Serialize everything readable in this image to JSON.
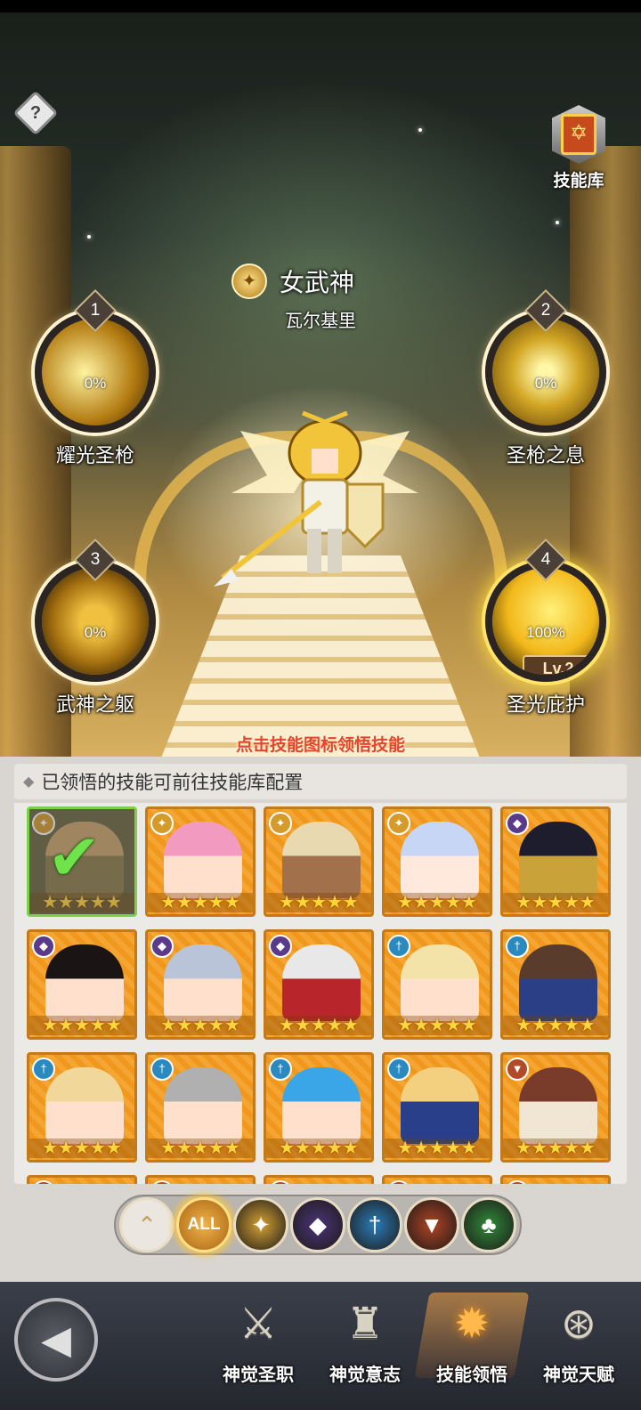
{
  "hero": {
    "title": "女武神",
    "subtitle": "瓦尔基里"
  },
  "skill_library": {
    "label": "技能库",
    "icon": "spellbook-icon"
  },
  "help": {
    "label": "?"
  },
  "skills": [
    {
      "num": "1",
      "name": "耀光圣枪",
      "progress": "0%"
    },
    {
      "num": "2",
      "name": "圣枪之息",
      "progress": "0%"
    },
    {
      "num": "3",
      "name": "武神之躯",
      "progress": "0%"
    },
    {
      "num": "4",
      "name": "圣光庇护",
      "progress": "100%",
      "level": "Lv.2"
    }
  ],
  "hint": "点击技能图标领悟技能",
  "panel": {
    "header": "已领悟的技能可前往技能库配置"
  },
  "cards": [
    {
      "faction": "light",
      "hair": "#c9a46a",
      "skin": "#8a7c4a",
      "selected": true
    },
    {
      "faction": "light",
      "hair": "#f39ac0",
      "skin": "#ffe0cc"
    },
    {
      "faction": "light",
      "hair": "#e8d9b0",
      "skin": "#a2704a"
    },
    {
      "faction": "light",
      "hair": "#c7d6f4",
      "skin": "#ffe8dc"
    },
    {
      "faction": "dark",
      "hair": "#1d1d2e",
      "skin": "#caa23a"
    },
    {
      "faction": "dark",
      "hair": "#1a1414",
      "skin": "#ffe0cc"
    },
    {
      "faction": "dark",
      "hair": "#b9c4d8",
      "skin": "#ffe0cc"
    },
    {
      "faction": "dark",
      "hair": "#e8e8e8",
      "skin": "#b8252a"
    },
    {
      "faction": "holy",
      "hair": "#f4e3a8",
      "skin": "#ffe0cc"
    },
    {
      "faction": "holy",
      "hair": "#5a3c2c",
      "skin": "#2b3f86"
    },
    {
      "faction": "holy",
      "hair": "#f2d79a",
      "skin": "#ffe0cc"
    },
    {
      "faction": "holy",
      "hair": "#b0b0b0",
      "skin": "#ffe0cc"
    },
    {
      "faction": "holy",
      "hair": "#3aa6e8",
      "skin": "#ffe0cc"
    },
    {
      "faction": "holy",
      "hair": "#f2d080",
      "skin": "#2a3f8a"
    },
    {
      "faction": "beast",
      "hair": "#7a3c2a",
      "skin": "#f1e6d4"
    },
    {
      "faction": "beast",
      "hair": "#555",
      "skin": "#444"
    },
    {
      "faction": "beast",
      "hair": "#555",
      "skin": "#444"
    },
    {
      "faction": "beast",
      "hair": "#e8c030",
      "skin": "#444"
    },
    {
      "faction": "beast",
      "hair": "#555",
      "skin": "#444"
    },
    {
      "faction": "beast",
      "hair": "#555",
      "skin": "#444"
    }
  ],
  "card_stars": "★★★★★",
  "factions": {
    "light": {
      "color": "#d49a2a",
      "glyph": "✦"
    },
    "dark": {
      "color": "#5a3a8a",
      "glyph": "◆"
    },
    "holy": {
      "color": "#2a8ac0",
      "glyph": "†"
    },
    "beast": {
      "color": "#b24a2a",
      "glyph": "▼"
    },
    "nature": {
      "color": "#2f8a3a",
      "glyph": "♣"
    }
  },
  "filters": [
    {
      "id": "up",
      "label": "⌃",
      "icon": "chevron-up-icon"
    },
    {
      "id": "all",
      "label": "ALL",
      "icon": "all-filter-icon"
    },
    {
      "id": "light",
      "label": "✦",
      "icon": "light-faction-icon",
      "color": "#d4a234"
    },
    {
      "id": "dark",
      "label": "◆",
      "icon": "dark-faction-icon",
      "color": "#4a3478"
    },
    {
      "id": "holy",
      "label": "†",
      "icon": "holy-faction-icon",
      "color": "#2a7cb8"
    },
    {
      "id": "beast",
      "label": "▼",
      "icon": "beast-faction-icon",
      "color": "#b04424"
    },
    {
      "id": "nature",
      "label": "♣",
      "icon": "nature-faction-icon",
      "color": "#2f8a3a"
    }
  ],
  "nav": {
    "back_label": "◀",
    "items": [
      {
        "label": "神觉圣职",
        "glyph": "⚔",
        "icon": "sacred-class-icon"
      },
      {
        "label": "神觉意志",
        "glyph": "♜",
        "icon": "divine-will-icon"
      },
      {
        "label": "技能领悟",
        "glyph": "✹",
        "icon": "skill-comprehension-icon",
        "active": true
      },
      {
        "label": "神觉天赋",
        "glyph": "⊛",
        "icon": "divine-talent-icon"
      }
    ]
  },
  "colors": {
    "accent": "#ffb84a",
    "hint": "#e3462a",
    "card": "#f5a532"
  }
}
